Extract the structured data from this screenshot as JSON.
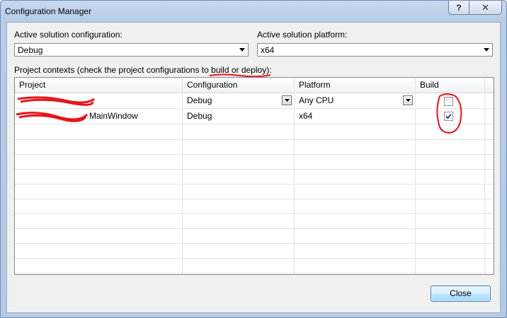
{
  "window": {
    "title": "Configuration Manager",
    "help_glyph": "?",
    "close_glyph": "✕"
  },
  "active_config": {
    "label": "Active solution configuration:",
    "value": "Debug"
  },
  "active_platform": {
    "label": "Active solution platform:",
    "value": "x64"
  },
  "contexts_label": "Project contexts (check the project configurations to build or deploy):",
  "grid": {
    "headers": [
      "Project",
      "Configuration",
      "Platform",
      "Build"
    ],
    "rows": [
      {
        "project": "",
        "configuration": "Debug",
        "platform": "Any CPU",
        "build_checked": false
      },
      {
        "project": "MainWindow",
        "configuration": "Debug",
        "platform": "x64",
        "build_checked": true
      }
    ]
  },
  "buttons": {
    "close": "Close"
  },
  "colors": {
    "annotation_red": "#e8141b",
    "accent_blue": "#3c7fb1"
  }
}
